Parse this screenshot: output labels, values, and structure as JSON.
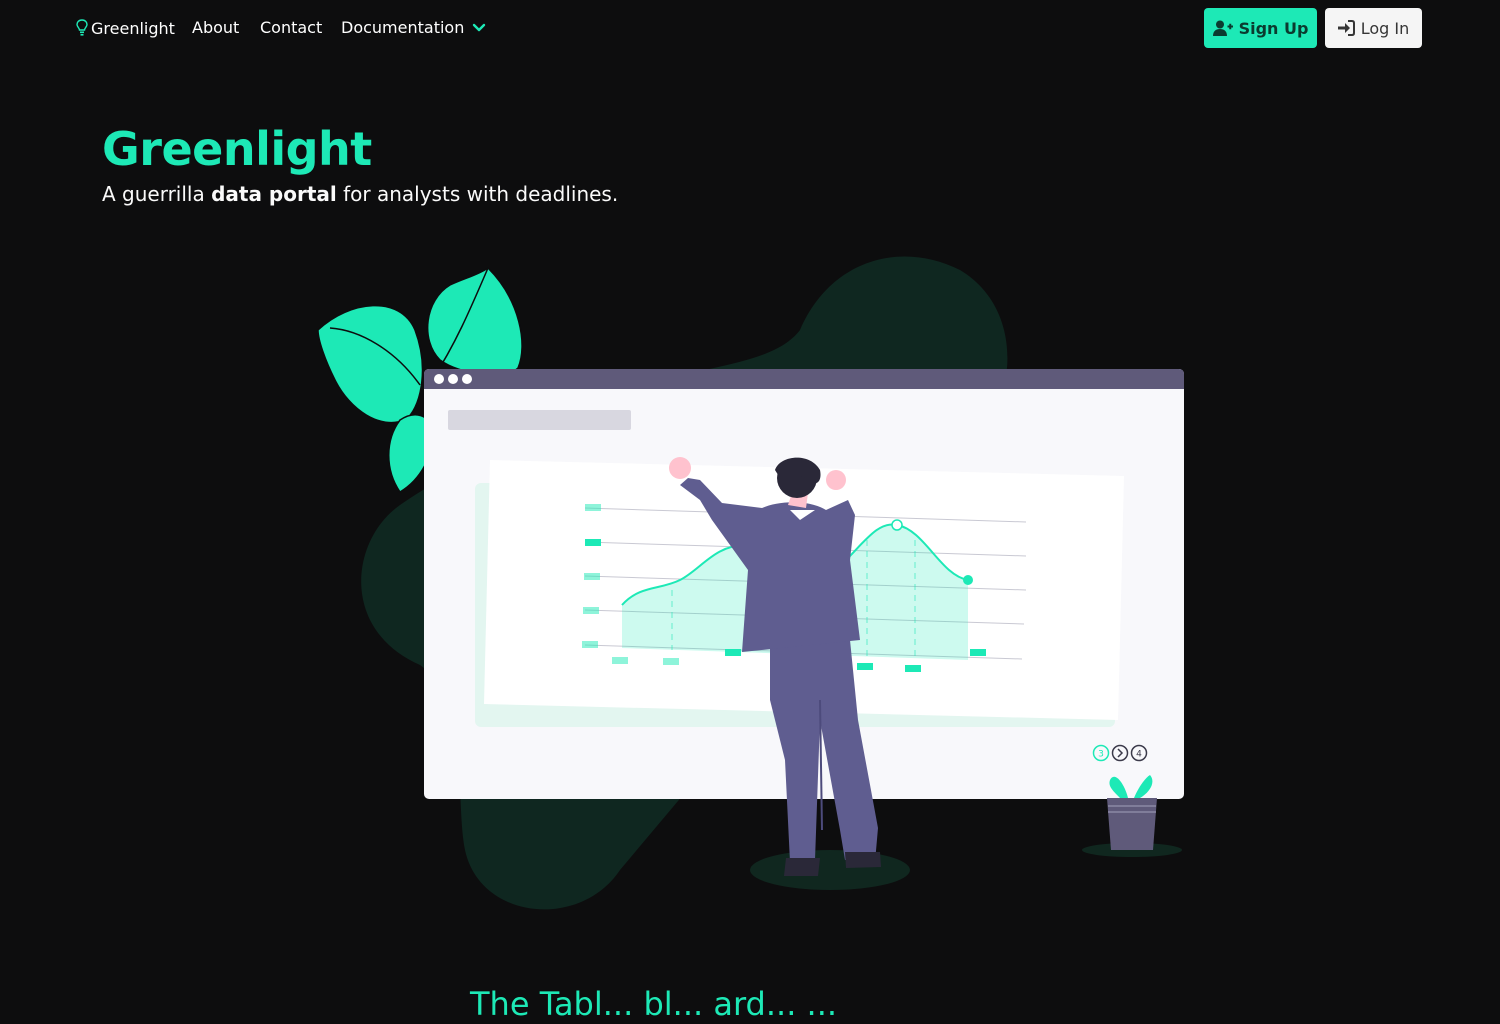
{
  "nav": {
    "brand": "Greenlight",
    "links": [
      "About",
      "Contact"
    ],
    "docs_label": "Documentation",
    "signup_label": "Sign Up",
    "login_label": "Log In"
  },
  "hero": {
    "title": "Greenlight",
    "subtitle_pre": "A guerrilla ",
    "subtitle_bold": "data portal",
    "subtitle_post": " for analysts with deadlines."
  },
  "illustration": {
    "pager": [
      "3",
      "4"
    ]
  },
  "colors": {
    "accent": "#1de9b6",
    "background": "#0d0d0e",
    "blob": "#0f2720",
    "browser_bar": "#5f5a7a",
    "figure_suit": "#5f5d90"
  },
  "next_section": {
    "visible_text": "The Tabl... bl... ard... ..."
  },
  "icons": [
    "lightbulb-icon",
    "chevron-down-icon",
    "user-plus-icon",
    "sign-in-icon",
    "chevron-right-icon"
  ]
}
